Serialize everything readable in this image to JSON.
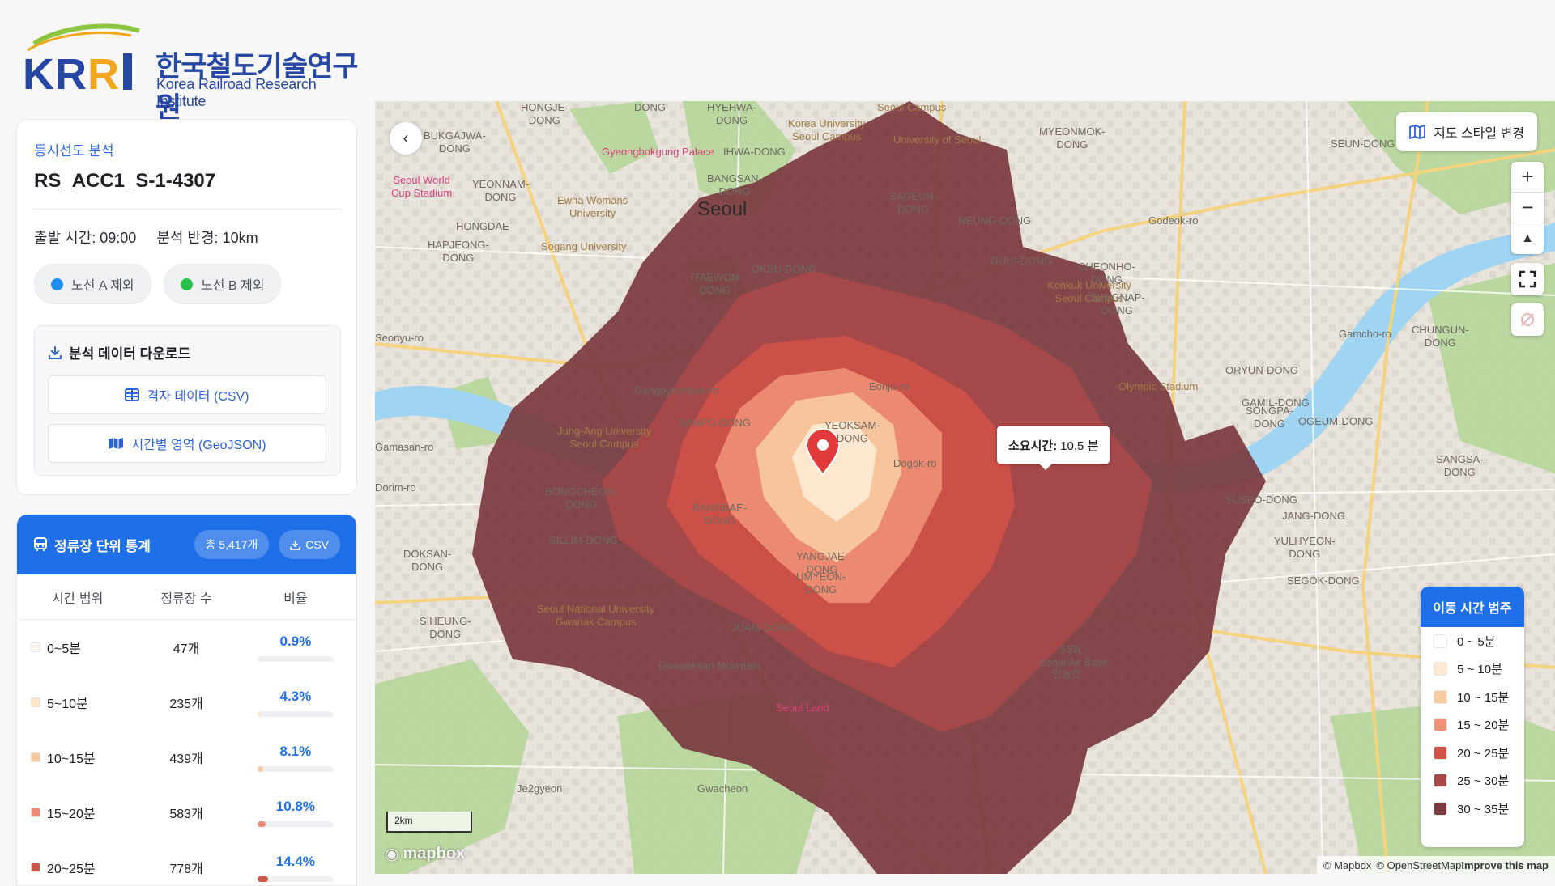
{
  "logo": {
    "text_kr": "한국철도기술연구원",
    "text_en": "Korea Railroad Research Institute"
  },
  "analysis": {
    "kicker": "등시선도 분석",
    "title": "RS_ACC1_S-1-4307",
    "departure": "출발 시간: 09:00",
    "radius": "분석 반경: 10km",
    "route_buttons": [
      {
        "label": "노선 A 제외",
        "color": "#1e8ef0"
      },
      {
        "label": "노선 B 제외",
        "color": "#27c24c"
      }
    ]
  },
  "download": {
    "title": "분석 데이터 다운로드",
    "grid_label": "격자 데이터 (CSV)",
    "geojson_label": "시간별 영역 (GeoJSON)"
  },
  "station_stats": {
    "title": "정류장 단위 통계",
    "total_badge": "총 5,417개",
    "csv_label": "CSV",
    "columns": [
      "시간 범위",
      "정류장 수",
      "비율"
    ],
    "rows": [
      {
        "range": "0~5분",
        "count": "47개",
        "pct": "0.9%",
        "fraction": 0.009,
        "color": "#fdf7f0"
      },
      {
        "range": "5~10분",
        "count": "235개",
        "pct": "4.3%",
        "fraction": 0.043,
        "color": "#fce5c9"
      },
      {
        "range": "10~15분",
        "count": "439개",
        "pct": "8.1%",
        "fraction": 0.081,
        "color": "#f9c99e"
      },
      {
        "range": "15~20분",
        "count": "583개",
        "pct": "10.8%",
        "fraction": 0.108,
        "color": "#f08a74"
      },
      {
        "range": "20~25분",
        "count": "778개",
        "pct": "14.4%",
        "fraction": 0.144,
        "color": "#d35448"
      }
    ]
  },
  "map": {
    "collapse_icon": "chevron-left-icon",
    "style_button": "지도 스타일 변경",
    "tooltip_label": "소요시간:",
    "tooltip_value": "10.5 분",
    "city": "Seoul",
    "scale": "2km",
    "mapbox": "mapbox",
    "attribution": [
      "© Mapbox",
      "© OpenStreetMap",
      "Improve this map"
    ],
    "legend": {
      "title": "이동 시간 범주",
      "items": [
        {
          "label": "0 ~ 5분",
          "color": "#ffffff"
        },
        {
          "label": "5 ~ 10분",
          "color": "#fde9d2"
        },
        {
          "label": "10 ~ 15분",
          "color": "#f9c9a0"
        },
        {
          "label": "15 ~ 20분",
          "color": "#f09076"
        },
        {
          "label": "20 ~ 25분",
          "color": "#cf5147"
        },
        {
          "label": "25 ~ 30분",
          "color": "#a8494a"
        },
        {
          "label": "30 ~ 35분",
          "color": "#7a3a3f"
        }
      ]
    },
    "labels": [
      {
        "text": "HONGJE-\nDONG",
        "cls": ""
      },
      {
        "text": "DONG",
        "cls": ""
      },
      {
        "text": "HYEHWA-\nDONG",
        "cls": ""
      },
      {
        "text": "Seoul Campus",
        "cls": "brown"
      },
      {
        "text": "Korea University\nSeoul Campus",
        "cls": "brown"
      },
      {
        "text": "University of Seoul",
        "cls": "brown"
      },
      {
        "text": "MYEONMOK-\nDONG",
        "cls": ""
      },
      {
        "text": "BUKGAJWA-\nDONG",
        "cls": ""
      },
      {
        "text": "Gyeongbokgung Palace",
        "cls": "pink"
      },
      {
        "text": "IHWA-DONG",
        "cls": ""
      },
      {
        "text": "SEUN-DONG",
        "cls": ""
      },
      {
        "text": "Seoul World\nCup Stadium",
        "cls": "pink"
      },
      {
        "text": "YEONNAM-\nDONG",
        "cls": ""
      },
      {
        "text": "Ewha Womans\nUniversity",
        "cls": "brown"
      },
      {
        "text": "BANGSAN-\nDONG",
        "cls": ""
      },
      {
        "text": "SAGEUN-\nDONG",
        "cls": ""
      },
      {
        "text": "Godeok-ro",
        "cls": ""
      },
      {
        "text": "HONGDAE",
        "cls": ""
      },
      {
        "text": "NEUNG-DONG",
        "cls": ""
      },
      {
        "text": "Sogang University",
        "cls": "brown"
      },
      {
        "text": "HAPJEONG-\nDONG",
        "cls": ""
      },
      {
        "text": "GUUI-DONG",
        "cls": ""
      },
      {
        "text": "CHEONHO-\nDONG",
        "cls": ""
      },
      {
        "text": "OKSU-DONG",
        "cls": ""
      },
      {
        "text": "ITAEWON\nDONG",
        "cls": ""
      },
      {
        "text": "Konkuk University\nSeoul Campus",
        "cls": "brown"
      },
      {
        "text": "SUNGNAP-\nDONG",
        "cls": ""
      },
      {
        "text": "Seonyu-ro",
        "cls": ""
      },
      {
        "text": "Gangbyeonbuk-ro",
        "cls": ""
      },
      {
        "text": "Gamcho-ro",
        "cls": ""
      },
      {
        "text": "CHUNGUN-\nDONG",
        "cls": ""
      },
      {
        "text": "ORYUN-DONG",
        "cls": ""
      },
      {
        "text": "Olympic Stadium",
        "cls": "brown"
      },
      {
        "text": "GAMIL-DONG",
        "cls": ""
      },
      {
        "text": "Gamasan-ro",
        "cls": ""
      },
      {
        "text": "BANPO-DONG",
        "cls": ""
      },
      {
        "text": "YEOKSAM-\nDONG",
        "cls": ""
      },
      {
        "text": "Eonju-ro",
        "cls": ""
      },
      {
        "text": "SONGPA-\nDONG",
        "cls": ""
      },
      {
        "text": "OGEUM-DONG",
        "cls": ""
      },
      {
        "text": "Jung-Ang University\nSeoul Campus",
        "cls": "brown"
      },
      {
        "text": "Dogok-ro",
        "cls": ""
      },
      {
        "text": "SANGSA-\nDONG",
        "cls": ""
      },
      {
        "text": "Dorim-ro",
        "cls": ""
      },
      {
        "text": "BONGCHEON-\nDONG",
        "cls": ""
      },
      {
        "text": "BANGBAE-\nDONG",
        "cls": ""
      },
      {
        "text": "SUSEO-DONG",
        "cls": ""
      },
      {
        "text": "JANG-DONG",
        "cls": ""
      },
      {
        "text": "SILLIM-DONG",
        "cls": ""
      },
      {
        "text": "YULHYEON-\nDONG",
        "cls": ""
      },
      {
        "text": "DOKSAN-\nDONG",
        "cls": ""
      },
      {
        "text": "YANGJAE-\nDONG",
        "cls": ""
      },
      {
        "text": "UMYEON-\nDONG",
        "cls": ""
      },
      {
        "text": "SEGOK-DONG",
        "cls": ""
      },
      {
        "text": "Seoul National University\nGwanak Campus",
        "cls": "brown"
      },
      {
        "text": "SIHEUNG-\nDONG",
        "cls": ""
      },
      {
        "text": "JUAM-DONG",
        "cls": ""
      },
      {
        "text": "Gwanaksan Mountain",
        "cls": ""
      },
      {
        "text": "인능산",
        "cls": ""
      },
      {
        "text": "SSN -\nSeoul Air Base",
        "cls": ""
      },
      {
        "text": "Seoul Land",
        "cls": "pink"
      },
      {
        "text": "Je2gyeon",
        "cls": ""
      },
      {
        "text": "Gwacheon",
        "cls": ""
      }
    ]
  }
}
